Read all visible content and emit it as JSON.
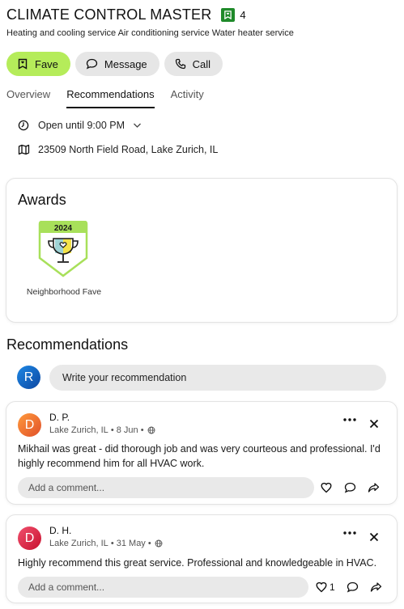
{
  "business": {
    "name": "CLIMATE CONTROL MASTER",
    "fave_count": "4",
    "categories": "Heating and cooling service Air conditioning service Water heater service"
  },
  "actions": {
    "fave": "Fave",
    "message": "Message",
    "call": "Call"
  },
  "tabs": [
    "Overview",
    "Recommendations",
    "Activity"
  ],
  "active_tab": "Recommendations",
  "info": {
    "hours": "Open until 9:00 PM",
    "address": "23509 North Field Road, Lake Zurich, IL"
  },
  "awards": {
    "title": "Awards",
    "items": [
      {
        "year": "2024",
        "label": "Neighborhood Fave"
      }
    ]
  },
  "recommendations": {
    "title": "Recommendations",
    "user_initial": "R",
    "write_placeholder": "Write your recommendation",
    "reviews": [
      {
        "initial": "D",
        "name": "D. P.",
        "location": "Lake Zurich, IL",
        "date": "8 Jun",
        "text": "Mikhail was great - did thorough job and was very courteous and professional. I'd highly recommend him for all HVAC work.",
        "comment_placeholder": "Add a comment...",
        "likes": ""
      },
      {
        "initial": "D",
        "name": "D. H.",
        "location": "Lake Zurich, IL",
        "date": "31 May",
        "text": "Highly recommend this great service. Professional and knowledgeable in HVAC.",
        "comment_placeholder": "Add a comment...",
        "likes": "1"
      }
    ]
  },
  "colors": {
    "fave_button": "#b5ec5a",
    "fave_badge": "#1f8a2a",
    "pill_gray": "#e6e6e6"
  }
}
